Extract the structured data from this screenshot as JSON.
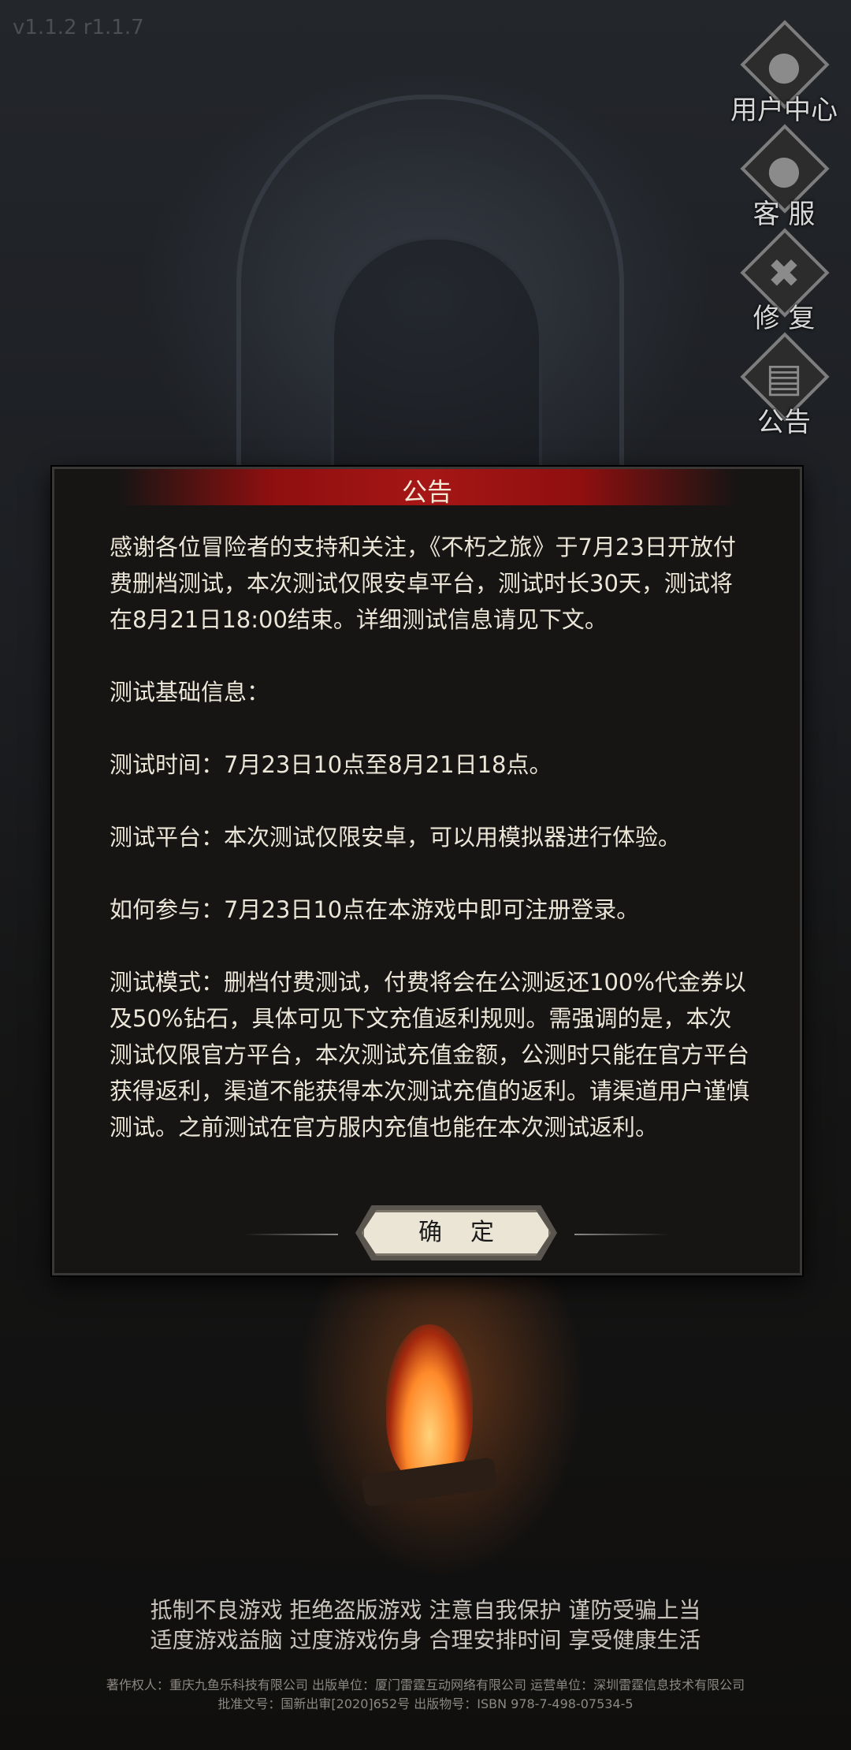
{
  "version": "v1.1.2 r1.1.7",
  "side_menu": [
    {
      "label": "用户中心",
      "icon": "user-center-icon",
      "glyph": "●"
    },
    {
      "label": "客 服",
      "icon": "customer-service-icon",
      "glyph": "●"
    },
    {
      "label": "修 复",
      "icon": "repair-icon",
      "glyph": "✖"
    },
    {
      "label": "公告",
      "icon": "notice-icon",
      "glyph": "▤"
    }
  ],
  "dialog": {
    "title": "公告",
    "paragraphs": [
      "感谢各位冒险者的支持和关注，《不朽之旅》于7月23日开放付费删档测试，本次测试仅限安卓平台，测试时长30天，测试将在8月21日18:00结束。详细测试信息请见下文。",
      "测试基础信息：",
      "测试时间：7月23日10点至8月21日18点。",
      "测试平台：本次测试仅限安卓，可以用模拟器进行体验。",
      "如何参与：7月23日10点在本游戏中即可注册登录。",
      "测试模式：删档付费测试，付费将会在公测返还100%代金券以及50%钻石，具体可见下文充值返利规则。需强调的是，本次测试仅限官方平台，本次测试充值金额，公测时只能在官方平台获得返利，渠道不能获得本次测试充值的返利。请渠道用户谨慎测试。之前测试在官方服内充值也能在本次测试返利。"
    ],
    "confirm_label": "确定"
  },
  "footer": {
    "notice_line1": "抵制不良游戏 拒绝盗版游戏 注意自我保护 谨防受骗上当",
    "notice_line2": "适度游戏益脑 过度游戏伤身 合理安排时间 享受健康生活",
    "credits_line1": "著作权人：重庆九鱼乐科技有限公司 出版单位：厦门雷霆互动网络有限公司 运营单位：深圳雷霆信息技术有限公司",
    "credits_line2": "批准文号：国新出审[2020]652号 出版物号：ISBN 978-7-498-07534-5"
  }
}
